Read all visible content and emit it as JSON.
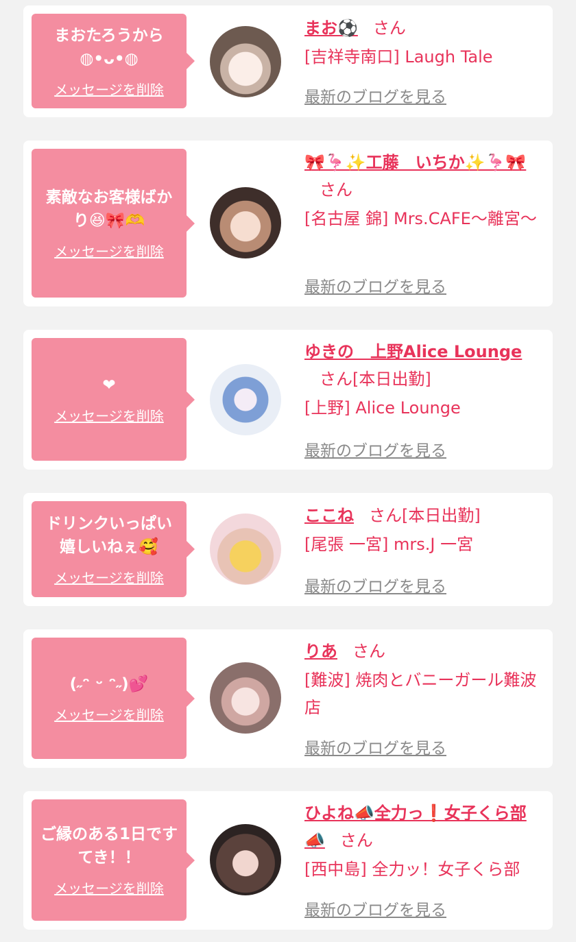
{
  "delete_label": "メッセージを削除",
  "blog_label": "最新のブログを見る",
  "san_label": "さん",
  "colors": {
    "accent": "#e8335a",
    "bubble": "#f48da0",
    "link_gray": "#8a8a8a",
    "background": "#f2f2f2"
  },
  "messages": [
    {
      "text": "まおたろうから\n◍•ᴗ•◍",
      "name": "まお⚽",
      "suffix": "さん",
      "shop": "[吉祥寺南口] Laugh Tale"
    },
    {
      "text": "素敵なお客様ばかり😆🎀🫶",
      "name": "🎀🦩✨工藤　いちか✨🦩🎀",
      "suffix": "さん",
      "shop": "[名古屋 錦] Mrs.CAFE〜離宮〜"
    },
    {
      "text": "❤",
      "name": "ゆきの　上野Alice Lounge",
      "suffix": "さん[本日出勤]",
      "shop": "[上野] Alice Lounge"
    },
    {
      "text": "ドリンクいっぱい嬉しいねぇ🥰",
      "name": "ここね",
      "suffix": "さん[本日出勤]",
      "shop": "[尾張 一宮] mrs.J 一宮"
    },
    {
      "text": "(˶ᵔ ᵕ ᵔ˶)💕",
      "name": "りあ",
      "suffix": "さん",
      "shop": "[難波] 焼肉とバニーガール難波店"
    },
    {
      "text": "ご縁のある1日ですてき！！",
      "name": "ひよね📣全力っ❗女子くら部📣",
      "suffix": "さん",
      "shop": "[西中島] 全力ッ！女子くら部"
    }
  ]
}
